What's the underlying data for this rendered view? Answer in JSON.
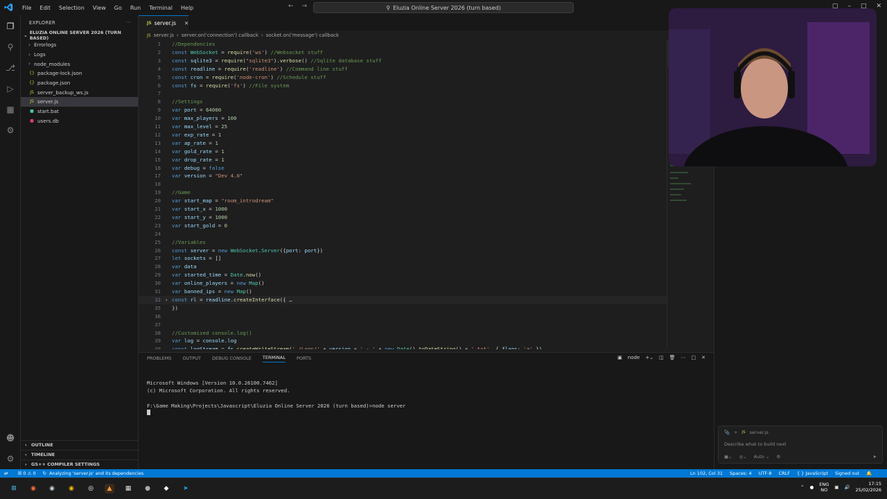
{
  "window": {
    "title": "Eluzia Online Server 2026 (turn based)",
    "menu": [
      "File",
      "Edit",
      "Selection",
      "View",
      "Go",
      "Run",
      "Terminal",
      "Help"
    ]
  },
  "sidebar": {
    "header": "EXPLORER",
    "root": "ELUZIA ONLINE SERVER 2026 (TURN BASED)",
    "items": [
      {
        "label": "Errorlogs",
        "type": "folder"
      },
      {
        "label": "Logs",
        "type": "folder"
      },
      {
        "label": "node_modules",
        "type": "folder"
      },
      {
        "label": "package-lock.json",
        "type": "json"
      },
      {
        "label": "package.json",
        "type": "json"
      },
      {
        "label": "server_backup_ws.js",
        "type": "js"
      },
      {
        "label": "server.js",
        "type": "js"
      },
      {
        "label": "start.bat",
        "type": "bat"
      },
      {
        "label": "users.db",
        "type": "db"
      }
    ],
    "sections": [
      "OUTLINE",
      "TIMELINE",
      "GS++ COMPILER SETTINGS"
    ]
  },
  "editor": {
    "tab": "server.js",
    "breadcrumb": [
      "server.js",
      "server.on('connection') callback",
      "socket.on('message') callback"
    ],
    "lines": [
      {
        "n": "1",
        "t": "//Dependencies"
      },
      {
        "n": "2",
        "t": "const WebSocket = require('ws') //Websocket stuff"
      },
      {
        "n": "3",
        "t": "const sqlite3 = require(\"sqlite3\").verbose() //Sqlite database stuff"
      },
      {
        "n": "4",
        "t": "const readline = require('readline') //Command line stuff"
      },
      {
        "n": "5",
        "t": "const cron = require('node-cron') //Schedule stuff"
      },
      {
        "n": "6",
        "t": "const fs = require('fs') //File system"
      },
      {
        "n": "7",
        "t": ""
      },
      {
        "n": "8",
        "t": "//Settings"
      },
      {
        "n": "9",
        "t": "var port = 64000"
      },
      {
        "n": "10",
        "t": "var max_players = 100"
      },
      {
        "n": "11",
        "t": "var max_level = 25"
      },
      {
        "n": "12",
        "t": "var exp_rate = 1"
      },
      {
        "n": "13",
        "t": "var ap_rate = 1"
      },
      {
        "n": "14",
        "t": "var gold_rate = 1"
      },
      {
        "n": "15",
        "t": "var drop_rate = 1"
      },
      {
        "n": "16",
        "t": "var debug = false"
      },
      {
        "n": "17",
        "t": "var version = \"Dev 4.0\""
      },
      {
        "n": "18",
        "t": ""
      },
      {
        "n": "19",
        "t": "//Game"
      },
      {
        "n": "20",
        "t": "var start_map = \"room_introdream\""
      },
      {
        "n": "21",
        "t": "var start_x = 1000"
      },
      {
        "n": "22",
        "t": "var start_y = 1000"
      },
      {
        "n": "23",
        "t": "var start_gold = 0"
      },
      {
        "n": "24",
        "t": ""
      },
      {
        "n": "25",
        "t": "//Variables"
      },
      {
        "n": "26",
        "t": "const server = new WebSocket.Server({port: port})"
      },
      {
        "n": "27",
        "t": "let sockets = []"
      },
      {
        "n": "28",
        "t": "var data"
      },
      {
        "n": "29",
        "t": "var started_time = Date.now()"
      },
      {
        "n": "30",
        "t": "var online_players = new Map()"
      },
      {
        "n": "31",
        "t": "var banned_ips = new Map()"
      },
      {
        "n": "32",
        "t": "const rl = readline.createInterface({ …"
      },
      {
        "n": "35",
        "t": "})"
      },
      {
        "n": "36",
        "t": ""
      },
      {
        "n": "37",
        "t": ""
      },
      {
        "n": "38",
        "t": "//Customized console.log()"
      },
      {
        "n": "39",
        "t": "var log = console.log"
      },
      {
        "n": "40",
        "t": "const logStream = fs.createWriteStream('./Logs/' + version + ' - ' + new Date().toDateString() + '.txt', { flags: 'a' })"
      }
    ]
  },
  "panel": {
    "tabs": [
      "PROBLEMS",
      "OUTPUT",
      "DEBUG CONSOLE",
      "TERMINAL",
      "PORTS"
    ],
    "active_tab": "TERMINAL",
    "shell": "node",
    "terminal_lines": [
      "Microsoft Windows [Version 10.0.26100.7462]",
      "(c) Microsoft Corporation. All rights reserved.",
      "",
      "F:\\Game Making\\Projects\\Javascript\\Eluzia Online Server 2026 (turn based)>node server"
    ]
  },
  "chat": {
    "context_file": "server.js",
    "placeholder": "Describe what to build next",
    "mode": "Auto"
  },
  "statusbar": {
    "errors": "0",
    "warnings": "0",
    "message": "Analyzing 'server.js' and its dependencies",
    "position": "Ln 102, Col 31",
    "spaces": "Spaces: 4",
    "encoding": "UTF-8",
    "eol": "CRLF",
    "language": "JavaScript",
    "account": "Signed out"
  },
  "taskbar": {
    "lang1": "ENG",
    "lang2": "NO",
    "time": "17:15",
    "date": "25/02/2026"
  },
  "colors": {
    "accent": "#0078d4",
    "background": "#1e1e1e",
    "sidebar": "#181818"
  }
}
